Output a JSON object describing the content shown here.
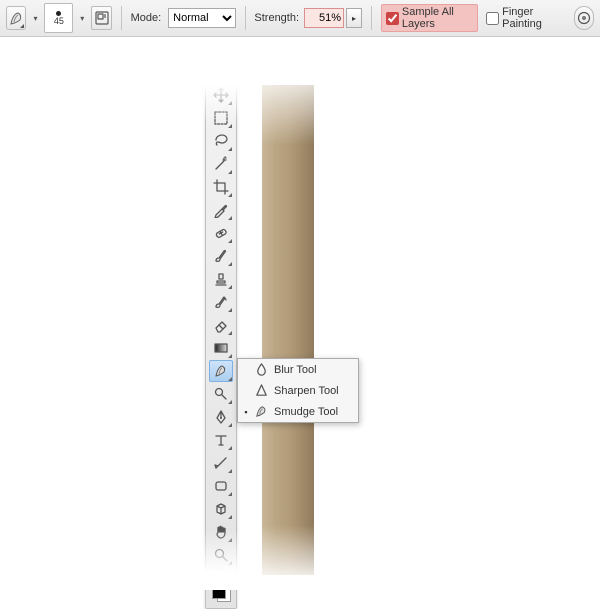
{
  "optionsBar": {
    "brushSize": "45",
    "modeLabel": "Mode:",
    "modeValue": "Normal",
    "strengthLabel": "Strength:",
    "strengthValue": "51%",
    "sampleAllLabel": "Sample All Layers",
    "sampleAllChecked": true,
    "fingerPaintLabel": "Finger Painting",
    "fingerPaintChecked": false
  },
  "flyout": {
    "items": [
      {
        "label": "Blur Tool",
        "selected": false,
        "icon": "droplet"
      },
      {
        "label": "Sharpen Tool",
        "selected": false,
        "icon": "triangle"
      },
      {
        "label": "Smudge Tool",
        "selected": true,
        "icon": "smudge"
      }
    ]
  },
  "tools": [
    {
      "name": "move-tool",
      "icon": "move"
    },
    {
      "name": "marquee-tool",
      "icon": "marquee"
    },
    {
      "name": "lasso-tool",
      "icon": "lasso"
    },
    {
      "name": "wand-tool",
      "icon": "wand"
    },
    {
      "name": "crop-tool",
      "icon": "crop"
    },
    {
      "name": "eyedropper-tool",
      "icon": "eyedropper"
    },
    {
      "name": "healing-tool",
      "icon": "healing"
    },
    {
      "name": "brush-tool",
      "icon": "brush"
    },
    {
      "name": "stamp-tool",
      "icon": "stamp"
    },
    {
      "name": "history-brush-tool",
      "icon": "history"
    },
    {
      "name": "eraser-tool",
      "icon": "eraser"
    },
    {
      "name": "gradient-tool",
      "icon": "gradient"
    },
    {
      "name": "smudge-tool",
      "icon": "smudge",
      "active": true
    },
    {
      "name": "dodge-tool",
      "icon": "dodge"
    },
    {
      "name": "pen-tool",
      "icon": "pen"
    },
    {
      "name": "type-tool",
      "icon": "type"
    },
    {
      "name": "path-tool",
      "icon": "path"
    },
    {
      "name": "shape-tool",
      "icon": "shape"
    },
    {
      "name": "3d-tool",
      "icon": "3d"
    },
    {
      "name": "hand-tool",
      "icon": "hand"
    },
    {
      "name": "zoom-tool",
      "icon": "zoom"
    }
  ]
}
